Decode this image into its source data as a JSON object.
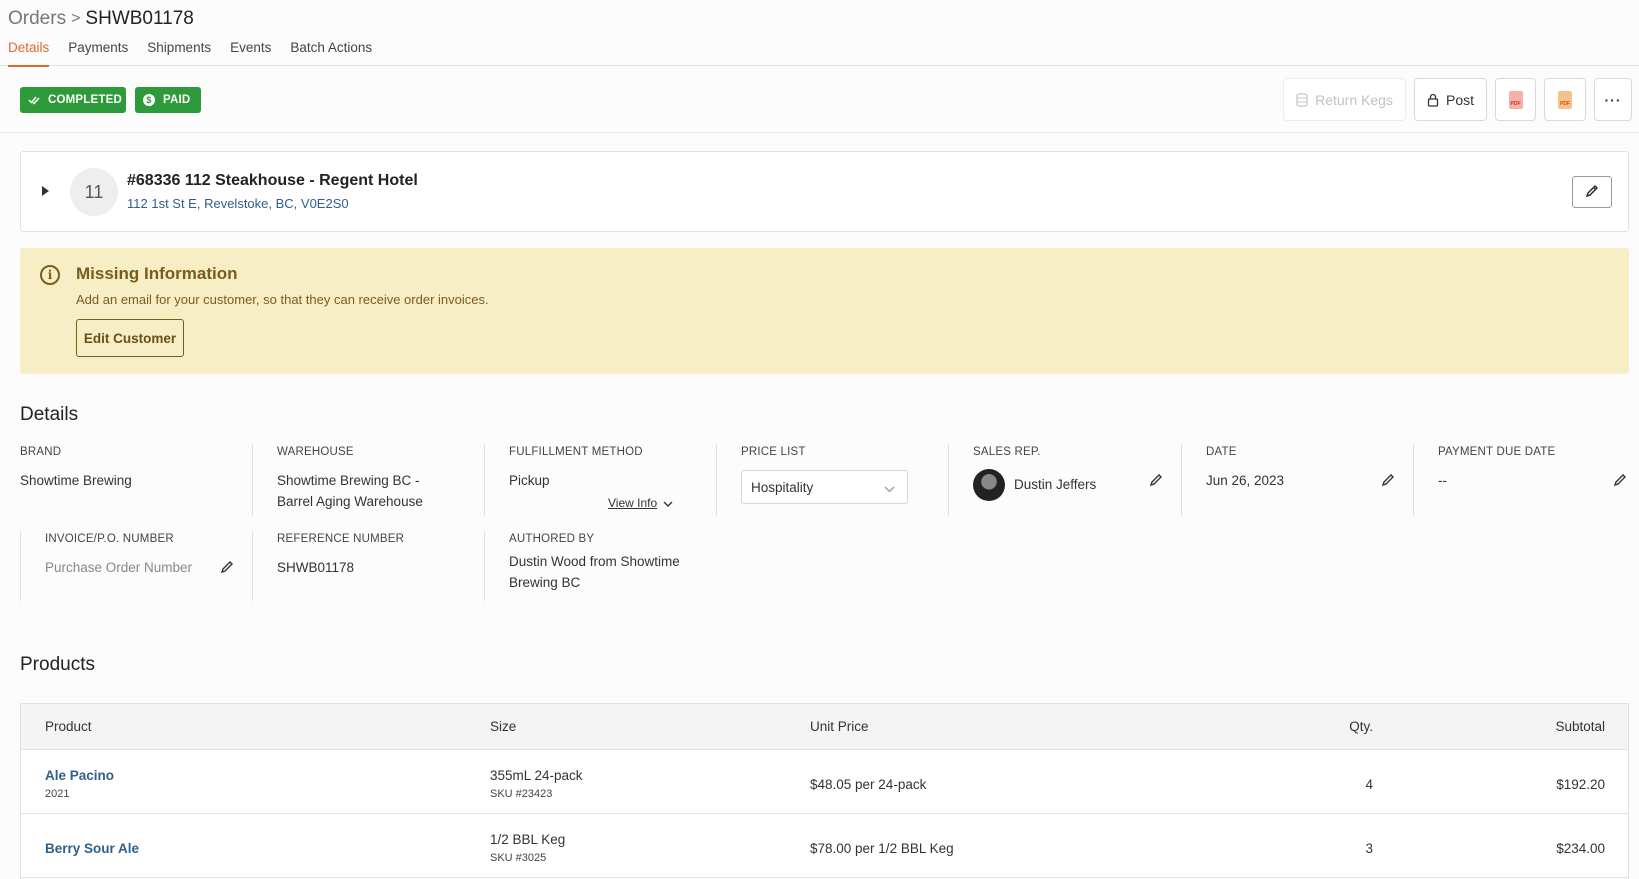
{
  "breadcrumb": {
    "parent": "Orders",
    "separator": ">",
    "current": "SHWB01178"
  },
  "tabs": [
    "Details",
    "Payments",
    "Shipments",
    "Events",
    "Batch Actions"
  ],
  "status": {
    "completed": "COMPLETED",
    "paid": "PAID",
    "paid_icon": "$"
  },
  "toolbar": {
    "return_kegs": "Return Kegs",
    "post": "Post",
    "pdf": "PDF",
    "more": "···"
  },
  "customer": {
    "number": "11",
    "name": "#68336 112 Steakhouse - Regent Hotel",
    "address": "112 1st St E, Revelstoke, BC, V0E2S0"
  },
  "alert": {
    "icon": "i",
    "title": "Missing Information",
    "text": "Add an email for your customer, so that they can receive order invoices.",
    "button": "Edit Customer"
  },
  "details": {
    "title": "Details",
    "brand": {
      "label": "BRAND",
      "value": "Showtime Brewing"
    },
    "warehouse": {
      "label": "WAREHOUSE",
      "line1": "Showtime Brewing BC -",
      "line2": "Barrel Aging Warehouse"
    },
    "fulfillment": {
      "label": "FULFILLMENT METHOD",
      "value": "Pickup",
      "view_info": "View Info"
    },
    "price_list": {
      "label": "PRICE LIST",
      "value": "Hospitality"
    },
    "sales_rep": {
      "label": "SALES REP.",
      "value": "Dustin Jeffers"
    },
    "date": {
      "label": "DATE",
      "value": "Jun 26, 2023"
    },
    "payment_due": {
      "label": "PAYMENT DUE DATE",
      "value": "--"
    },
    "invoice": {
      "label": "INVOICE/P.O. NUMBER",
      "placeholder": "Purchase Order Number"
    },
    "reference": {
      "label": "REFERENCE NUMBER",
      "value": "SHWB01178"
    },
    "authored": {
      "label": "AUTHORED BY",
      "line1": "Dustin Wood from Showtime",
      "line2": "Brewing BC"
    }
  },
  "products": {
    "title": "Products",
    "columns": {
      "product": "Product",
      "size": "Size",
      "unit_price": "Unit Price",
      "qty": "Qty.",
      "subtotal": "Subtotal"
    },
    "rows": [
      {
        "name": "Ale Pacino",
        "year": "2021",
        "size": "355mL 24-pack",
        "sku": "SKU #23423",
        "unit_price": "$48.05 per 24-pack",
        "qty": "4",
        "subtotal": "$192.20"
      },
      {
        "name": "Berry Sour Ale",
        "year": "",
        "size": "1/2 BBL Keg",
        "sku": "SKU #3025",
        "unit_price": "$78.00 per 1/2 BBL Keg",
        "qty": "3",
        "subtotal": "$234.00"
      }
    ]
  },
  "colors": {
    "accent": "#e2672c",
    "success": "#2e9b3a",
    "alert_bg": "#f7eec6",
    "alert_text": "#7a5c1d",
    "link": "#2f5f8a"
  }
}
